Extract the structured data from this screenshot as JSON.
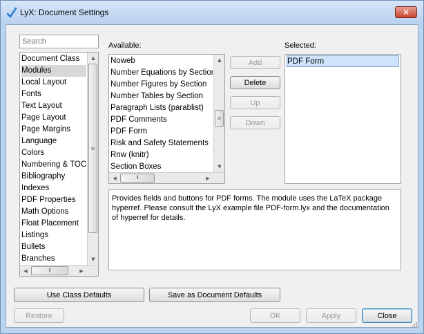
{
  "window": {
    "title": "LyX: Document Settings",
    "close_glyph": "✕"
  },
  "search": {
    "placeholder": "Search"
  },
  "categories": {
    "items": [
      "Document Class",
      "Modules",
      "Local Layout",
      "Fonts",
      "Text Layout",
      "Page Layout",
      "Page Margins",
      "Language",
      "Colors",
      "Numbering & TOC",
      "Bibliography",
      "Indexes",
      "PDF Properties",
      "Math Options",
      "Float Placement",
      "Listings",
      "Bullets",
      "Branches"
    ],
    "selected": "Modules"
  },
  "available": {
    "label": "Available:",
    "items": [
      "Noweb",
      "Number Equations by Section",
      "Number Figures by Section",
      "Number Tables by Section",
      "Paragraph Lists (parablist)",
      "PDF Comments",
      "PDF Form",
      "Risk and Safety Statements",
      "Rnw (knitr)",
      "Section Boxes"
    ]
  },
  "selected_modules": {
    "label": "Selected:",
    "items": [
      "PDF Form"
    ]
  },
  "module_buttons": {
    "add": "Add",
    "delete": "Delete",
    "up": "Up",
    "down": "Down"
  },
  "description": "Provides fields and buttons for PDF forms. The module uses the LaTeX package hyperref. Please consult the LyX example file PDF-form.lyx and the documentation of hyperref for details.",
  "bottom_buttons": {
    "use_class_defaults": "Use Class Defaults",
    "save_as_defaults": "Save as Document Defaults",
    "restore": "Restore",
    "ok": "OK",
    "apply": "Apply",
    "close": "Close"
  },
  "colors": {
    "accent": "#3c7fb1",
    "selection": "#cde4fa"
  }
}
